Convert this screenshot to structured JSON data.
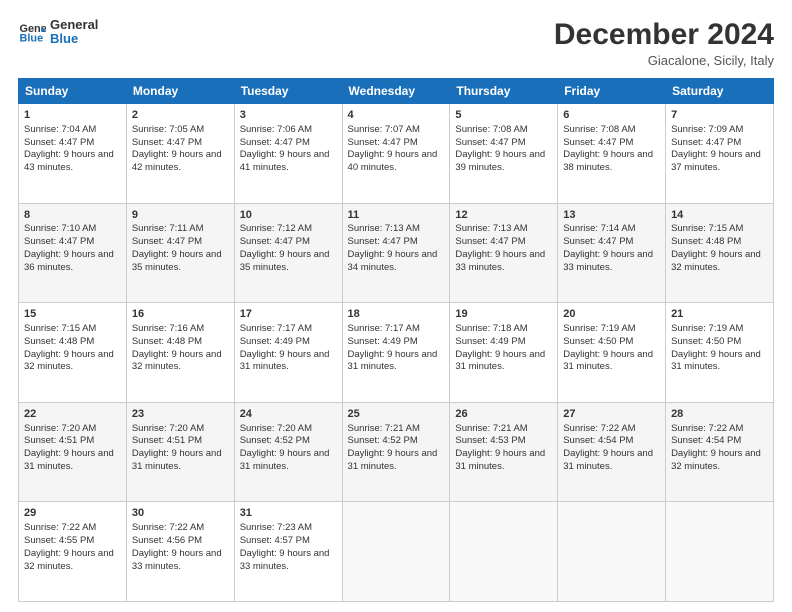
{
  "header": {
    "logo_line1": "General",
    "logo_line2": "Blue",
    "title": "December 2024",
    "subtitle": "Giacalone, Sicily, Italy"
  },
  "weekdays": [
    "Sunday",
    "Monday",
    "Tuesday",
    "Wednesday",
    "Thursday",
    "Friday",
    "Saturday"
  ],
  "weeks": [
    [
      {
        "day": 1,
        "sunrise": "7:04 AM",
        "sunset": "4:47 PM",
        "daylight": "9 hours and 43 minutes."
      },
      {
        "day": 2,
        "sunrise": "7:05 AM",
        "sunset": "4:47 PM",
        "daylight": "9 hours and 42 minutes."
      },
      {
        "day": 3,
        "sunrise": "7:06 AM",
        "sunset": "4:47 PM",
        "daylight": "9 hours and 41 minutes."
      },
      {
        "day": 4,
        "sunrise": "7:07 AM",
        "sunset": "4:47 PM",
        "daylight": "9 hours and 40 minutes."
      },
      {
        "day": 5,
        "sunrise": "7:08 AM",
        "sunset": "4:47 PM",
        "daylight": "9 hours and 39 minutes."
      },
      {
        "day": 6,
        "sunrise": "7:08 AM",
        "sunset": "4:47 PM",
        "daylight": "9 hours and 38 minutes."
      },
      {
        "day": 7,
        "sunrise": "7:09 AM",
        "sunset": "4:47 PM",
        "daylight": "9 hours and 37 minutes."
      }
    ],
    [
      {
        "day": 8,
        "sunrise": "7:10 AM",
        "sunset": "4:47 PM",
        "daylight": "9 hours and 36 minutes."
      },
      {
        "day": 9,
        "sunrise": "7:11 AM",
        "sunset": "4:47 PM",
        "daylight": "9 hours and 35 minutes."
      },
      {
        "day": 10,
        "sunrise": "7:12 AM",
        "sunset": "4:47 PM",
        "daylight": "9 hours and 35 minutes."
      },
      {
        "day": 11,
        "sunrise": "7:13 AM",
        "sunset": "4:47 PM",
        "daylight": "9 hours and 34 minutes."
      },
      {
        "day": 12,
        "sunrise": "7:13 AM",
        "sunset": "4:47 PM",
        "daylight": "9 hours and 33 minutes."
      },
      {
        "day": 13,
        "sunrise": "7:14 AM",
        "sunset": "4:47 PM",
        "daylight": "9 hours and 33 minutes."
      },
      {
        "day": 14,
        "sunrise": "7:15 AM",
        "sunset": "4:48 PM",
        "daylight": "9 hours and 32 minutes."
      }
    ],
    [
      {
        "day": 15,
        "sunrise": "7:15 AM",
        "sunset": "4:48 PM",
        "daylight": "9 hours and 32 minutes."
      },
      {
        "day": 16,
        "sunrise": "7:16 AM",
        "sunset": "4:48 PM",
        "daylight": "9 hours and 32 minutes."
      },
      {
        "day": 17,
        "sunrise": "7:17 AM",
        "sunset": "4:49 PM",
        "daylight": "9 hours and 31 minutes."
      },
      {
        "day": 18,
        "sunrise": "7:17 AM",
        "sunset": "4:49 PM",
        "daylight": "9 hours and 31 minutes."
      },
      {
        "day": 19,
        "sunrise": "7:18 AM",
        "sunset": "4:49 PM",
        "daylight": "9 hours and 31 minutes."
      },
      {
        "day": 20,
        "sunrise": "7:19 AM",
        "sunset": "4:50 PM",
        "daylight": "9 hours and 31 minutes."
      },
      {
        "day": 21,
        "sunrise": "7:19 AM",
        "sunset": "4:50 PM",
        "daylight": "9 hours and 31 minutes."
      }
    ],
    [
      {
        "day": 22,
        "sunrise": "7:20 AM",
        "sunset": "4:51 PM",
        "daylight": "9 hours and 31 minutes."
      },
      {
        "day": 23,
        "sunrise": "7:20 AM",
        "sunset": "4:51 PM",
        "daylight": "9 hours and 31 minutes."
      },
      {
        "day": 24,
        "sunrise": "7:20 AM",
        "sunset": "4:52 PM",
        "daylight": "9 hours and 31 minutes."
      },
      {
        "day": 25,
        "sunrise": "7:21 AM",
        "sunset": "4:52 PM",
        "daylight": "9 hours and 31 minutes."
      },
      {
        "day": 26,
        "sunrise": "7:21 AM",
        "sunset": "4:53 PM",
        "daylight": "9 hours and 31 minutes."
      },
      {
        "day": 27,
        "sunrise": "7:22 AM",
        "sunset": "4:54 PM",
        "daylight": "9 hours and 31 minutes."
      },
      {
        "day": 28,
        "sunrise": "7:22 AM",
        "sunset": "4:54 PM",
        "daylight": "9 hours and 32 minutes."
      }
    ],
    [
      {
        "day": 29,
        "sunrise": "7:22 AM",
        "sunset": "4:55 PM",
        "daylight": "9 hours and 32 minutes."
      },
      {
        "day": 30,
        "sunrise": "7:22 AM",
        "sunset": "4:56 PM",
        "daylight": "9 hours and 33 minutes."
      },
      {
        "day": 31,
        "sunrise": "7:23 AM",
        "sunset": "4:57 PM",
        "daylight": "9 hours and 33 minutes."
      },
      null,
      null,
      null,
      null
    ]
  ]
}
